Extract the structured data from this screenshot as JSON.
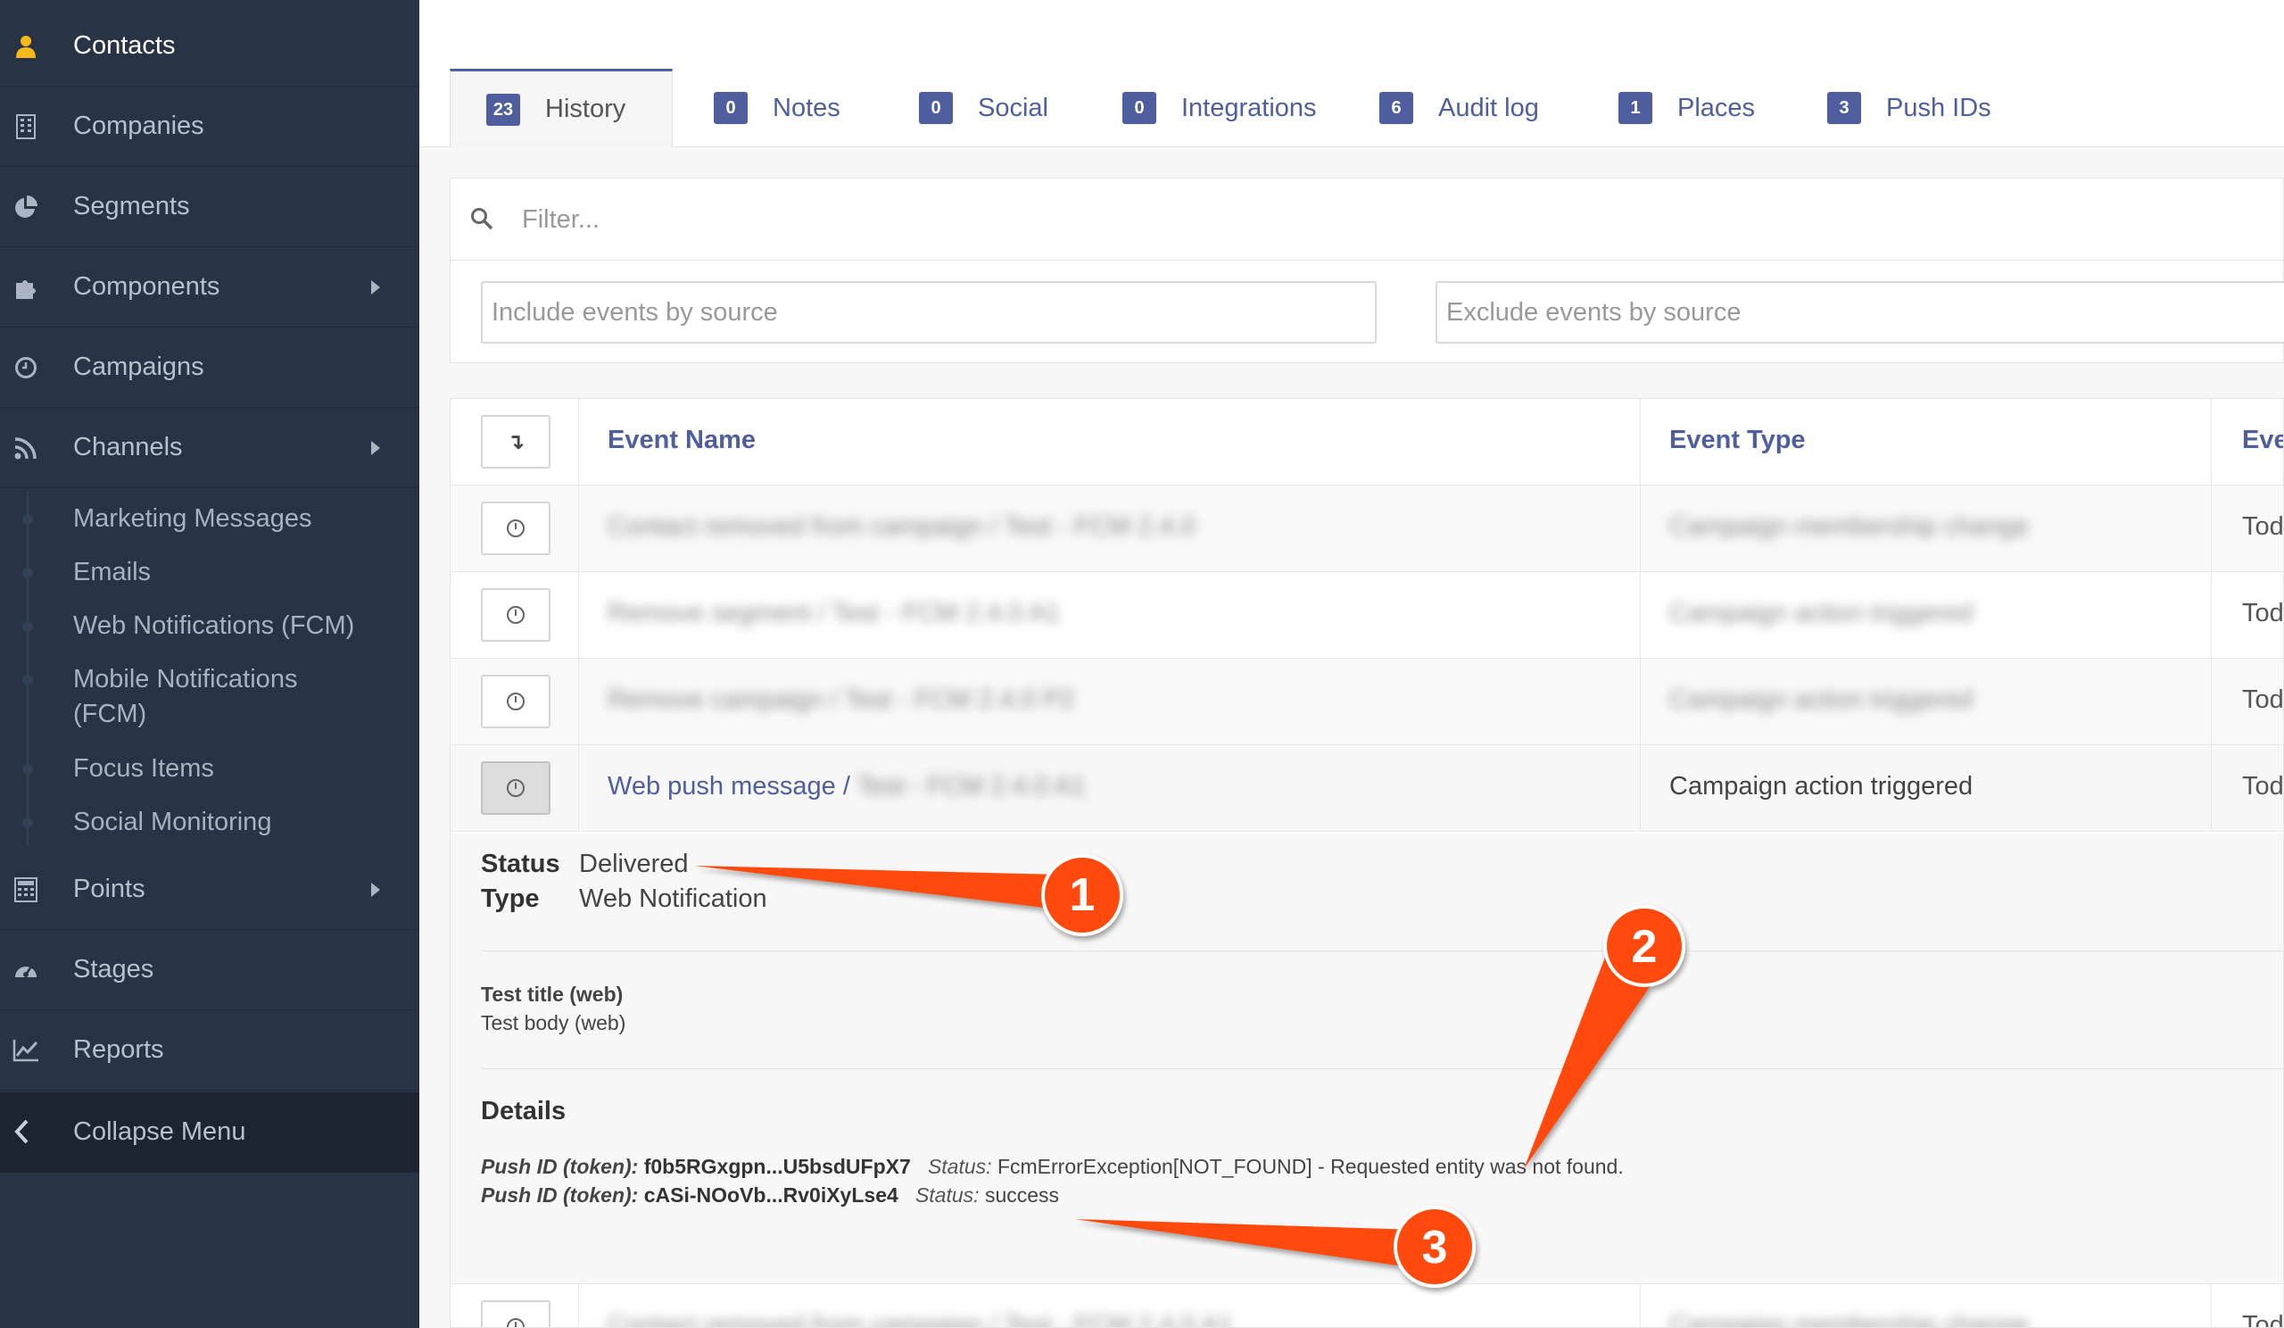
{
  "sidebar": {
    "items": [
      {
        "label": "Contacts",
        "icon": "user-icon"
      },
      {
        "label": "Companies",
        "icon": "building-icon"
      },
      {
        "label": "Segments",
        "icon": "pie-chart-icon"
      },
      {
        "label": "Components",
        "icon": "puzzle-icon"
      },
      {
        "label": "Campaigns",
        "icon": "clock-icon"
      },
      {
        "label": "Channels",
        "icon": "rss-icon"
      }
    ],
    "channels_sub": [
      "Marketing Messages",
      "Emails",
      "Web Notifications (FCM)",
      "Mobile Notifications",
      "(FCM)",
      "Focus Items",
      "Social Monitoring"
    ],
    "items_bottom": [
      {
        "label": "Points",
        "icon": "calculator-icon"
      },
      {
        "label": "Stages",
        "icon": "dashboard-icon"
      },
      {
        "label": "Reports",
        "icon": "line-chart-icon"
      }
    ],
    "collapse_label": "Collapse Menu"
  },
  "tabs": [
    {
      "count": "23",
      "label": "History"
    },
    {
      "count": "0",
      "label": "Notes"
    },
    {
      "count": "0",
      "label": "Social"
    },
    {
      "count": "0",
      "label": "Integrations"
    },
    {
      "count": "6",
      "label": "Audit log"
    },
    {
      "count": "1",
      "label": "Places"
    },
    {
      "count": "3",
      "label": "Push IDs"
    }
  ],
  "filter": {
    "placeholder": "Filter...",
    "include_placeholder": "Include events by source",
    "exclude_placeholder": "Exclude events by source"
  },
  "table": {
    "headers": {
      "sort_glyph": "↴",
      "name": "Event Name",
      "type": "Event Type",
      "timestamp": "Eve"
    },
    "rows": [
      {
        "name": "Contact removed from campaign / Test - FCM 2.4.0",
        "type": "Campaign membership change",
        "ts": "Tod"
      },
      {
        "name": "Remove segment / Test - FCM 2.4.0 A1",
        "type": "Campaign action triggered",
        "ts": "Tod"
      },
      {
        "name": "Remove campaign / Test - FCM 2.4.0 P2",
        "type": "Campaign action triggered",
        "ts": "Tod"
      },
      {
        "name_visible": "Web push message / ",
        "name_blurred": "Test - FCM 2.4.0 A1",
        "type": "Campaign action triggered",
        "ts": "Tod"
      }
    ],
    "last_row": {
      "name": "Contact removed from campaign / Test - FCM 2.4.0 A1",
      "type": "Campaign membership change",
      "ts": "Tod"
    }
  },
  "detail": {
    "status_label": "Status",
    "status_value": "Delivered",
    "type_label": "Type",
    "type_value": "Web Notification",
    "title": "Test title (web)",
    "body": "Test body (web)",
    "details_heading": "Details",
    "tokens": [
      {
        "label": "Push ID (token):",
        "value": "f0b5RGxgpn...U5bsdUFpX7",
        "status_label": "Status:",
        "status": "FcmErrorException[NOT_FOUND] - Requested entity was not found."
      },
      {
        "label": "Push ID (token):",
        "value": "cASi-NOoVb...Rv0iXyLse4",
        "status_label": "Status:",
        "status": "success"
      }
    ]
  },
  "callouts": [
    "1",
    "2",
    "3"
  ],
  "colors": {
    "sidebar": "#283445",
    "accent": "#4e5e9e",
    "callout": "#ff4a0a"
  }
}
